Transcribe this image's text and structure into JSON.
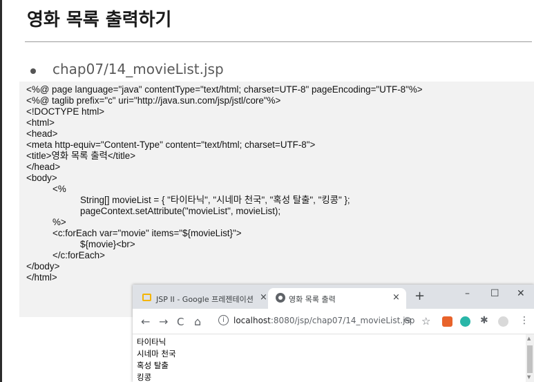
{
  "slide": {
    "title": "영화 목록 출력하기",
    "bullet_text": "chap07/14_movieList.jsp"
  },
  "code_lines": [
    "<%@ page language=\"java\" contentType=\"text/html; charset=UTF-8\" pageEncoding=\"UTF-8\"%>",
    "<%@ taglib prefix=\"c\" uri=\"http://java.sun.com/jsp/jstl/core\"%>",
    "<!DOCTYPE html>",
    "<html>",
    "<head>",
    "<meta http-equiv=\"Content-Type\" content=\"text/html; charset=UTF-8\">",
    "<title>영화 목록 출력</title>",
    "</head>",
    "<body>",
    "<%",
    "String[] movieList = { \"타이타닉\", \"시네마 천국\", \"혹성 탈출\", \"킹콩\" };",
    "pageContext.setAttribute(\"movieList\", movieList);",
    "%>",
    "<c:forEach var=\"movie\" items=\"${movieList}\">",
    "${movie}<br>",
    "</c:forEach>",
    "</body>",
    "</html>"
  ],
  "browser": {
    "tabs": [
      {
        "label": "JSP II - Google 프레젠테이션",
        "close": "×"
      },
      {
        "label": "영화 목록 출력",
        "close": "×"
      }
    ],
    "new_tab": "+",
    "window_controls": {
      "minimize": "–",
      "maximize": "☐",
      "close": "✕"
    },
    "nav": {
      "back": "←",
      "forward": "→",
      "reload": "C",
      "home": "⌂"
    },
    "url_host": "localhost",
    "url_rest": ":8080/jsp/chap07/14_movieList.jsp",
    "info_glyph": "i",
    "zoom_glyph": "⊖",
    "star_glyph": "☆",
    "puzzle_glyph": "✱",
    "menu_glyph": "⋮",
    "page_output": [
      "타이타닉",
      "시네마 천국",
      "혹성 탈출",
      "킹콩"
    ]
  }
}
